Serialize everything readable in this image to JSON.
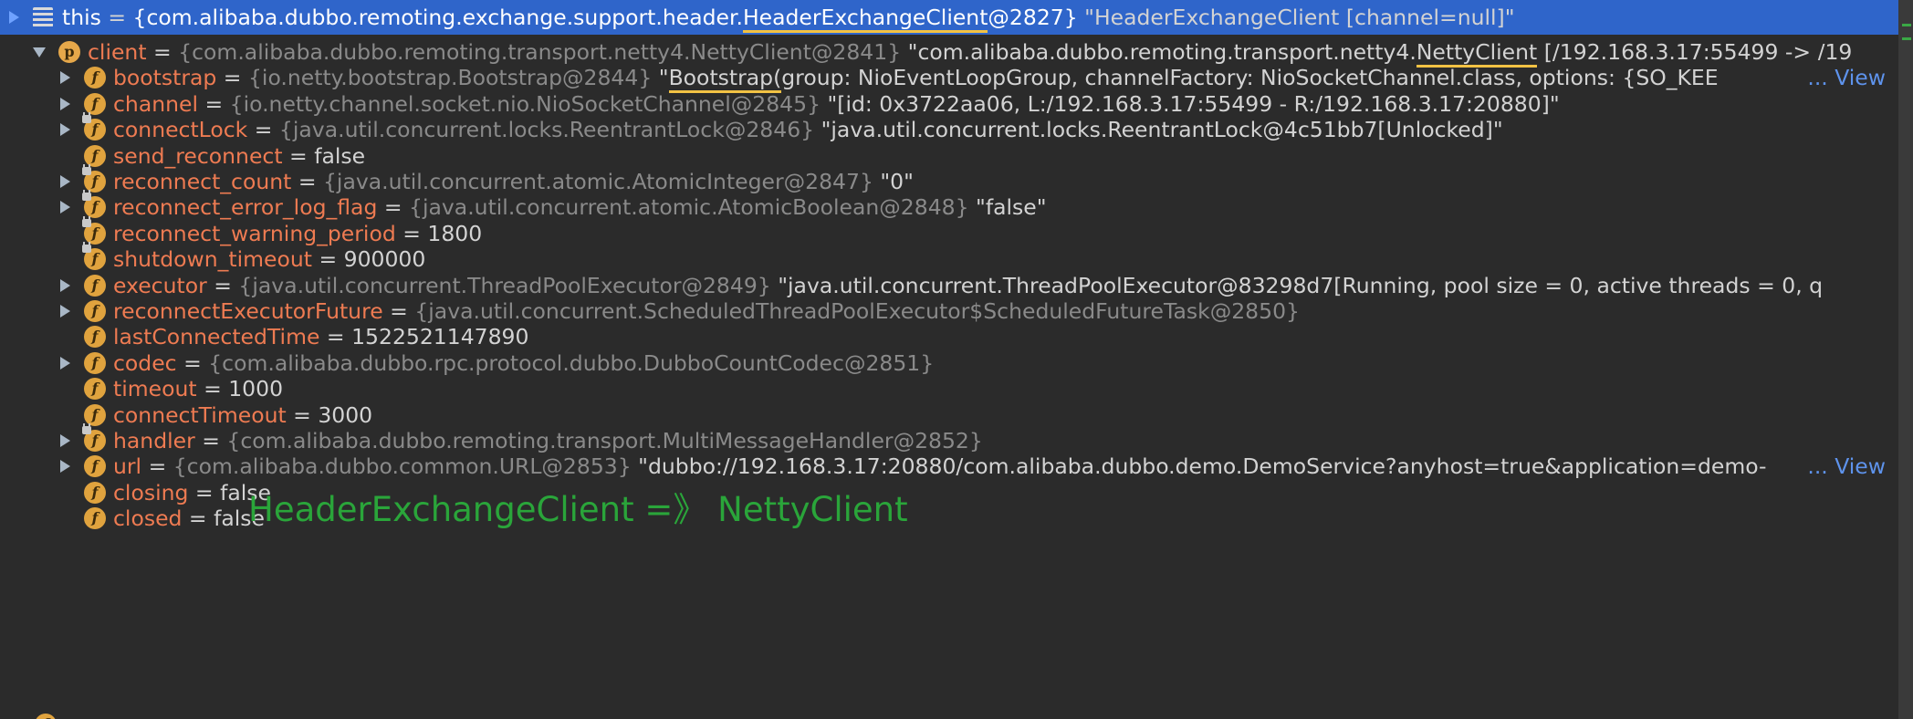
{
  "rows": [
    {
      "id": "this",
      "indent": 0,
      "arrow": "right",
      "icon": "lines",
      "selected": true,
      "name": "this",
      "sep": " = ",
      "gray": "{com.alibaba.dubbo.remoting.exchange.support.header.",
      "gray_ul": "HeaderExchangeClient",
      "gray_tail": "@2827}",
      "value": " \"HeaderExchangeClient [channel=null]\""
    },
    {
      "id": "client",
      "indent": 1,
      "arrow": "down",
      "icon": "p",
      "name": "client",
      "sep": " = ",
      "gray": "{com.alibaba.dubbo.remoting.transport.netty4.NettyClient@2841}",
      "value": " \"com.alibaba.dubbo.remoting.transport.netty4.",
      "value_ul": "NettyClient",
      "value_tail": " [/192.168.3.17:55499 -> /19"
    },
    {
      "id": "bootstrap",
      "indent": 2,
      "arrow": "right",
      "icon": "f",
      "name": "bootstrap",
      "sep": " = ",
      "gray": "{io.netty.bootstrap.Bootstrap@2844}",
      "value": " \"",
      "value_ul": "Bootstrap(",
      "value_tail": "group: NioEventLoopGroup, channelFactory: NioSocketChannel.class, options: {SO_KEE",
      "view": "... View"
    },
    {
      "id": "channel",
      "indent": 2,
      "arrow": "right",
      "icon": "f",
      "name": "channel",
      "sep": " = ",
      "gray": "{io.netty.channel.socket.nio.NioSocketChannel@2845}",
      "value": " \"[id: 0x3722aa06, L:/192.168.3.17:55499 - R:/192.168.3.17:20880]\""
    },
    {
      "id": "connectLock",
      "indent": 2,
      "arrow": "right",
      "icon": "f",
      "lock": true,
      "name": "connectLock",
      "sep": " = ",
      "gray": "{java.util.concurrent.locks.ReentrantLock@2846}",
      "value": " \"java.util.concurrent.locks.ReentrantLock@4c51bb7[Unlocked]\""
    },
    {
      "id": "send_reconnect",
      "indent": 2,
      "arrow": "none",
      "icon": "f",
      "name": "send_reconnect",
      "sep": " = ",
      "value": "false"
    },
    {
      "id": "reconnect_count",
      "indent": 2,
      "arrow": "right",
      "icon": "f",
      "lock": true,
      "name": "reconnect_count",
      "sep": " = ",
      "gray": "{java.util.concurrent.atomic.AtomicInteger@2847}",
      "value": " \"0\""
    },
    {
      "id": "reconnect_error_log_flag",
      "indent": 2,
      "arrow": "right",
      "icon": "f",
      "lock": true,
      "name": "reconnect_error_log_flag",
      "sep": " = ",
      "gray": "{java.util.concurrent.atomic.AtomicBoolean@2848}",
      "value": " \"false\""
    },
    {
      "id": "reconnect_warning_period",
      "indent": 2,
      "arrow": "none",
      "icon": "f",
      "lock": true,
      "name": "reconnect_warning_period",
      "sep": " = ",
      "value": "1800"
    },
    {
      "id": "shutdown_timeout",
      "indent": 2,
      "arrow": "none",
      "icon": "f",
      "lock": true,
      "name": "shutdown_timeout",
      "sep": " = ",
      "value": "900000"
    },
    {
      "id": "executor",
      "indent": 2,
      "arrow": "right",
      "icon": "f",
      "name": "executor",
      "sep": " = ",
      "gray": "{java.util.concurrent.ThreadPoolExecutor@2849}",
      "value": " \"java.util.concurrent.ThreadPoolExecutor@83298d7[Running, pool size = 0, active threads = 0, q"
    },
    {
      "id": "reconnectExecutorFuture",
      "indent": 2,
      "arrow": "right",
      "icon": "f",
      "name": "reconnectExecutorFuture",
      "sep": " = ",
      "gray": "{java.util.concurrent.ScheduledThreadPoolExecutor$ScheduledFutureTask@2850}"
    },
    {
      "id": "lastConnectedTime",
      "indent": 2,
      "arrow": "none",
      "icon": "f",
      "name": "lastConnectedTime",
      "sep": " = ",
      "value": "1522521147890"
    },
    {
      "id": "codec",
      "indent": 2,
      "arrow": "right",
      "icon": "f",
      "name": "codec",
      "sep": " = ",
      "gray": "{com.alibaba.dubbo.rpc.protocol.dubbo.DubboCountCodec@2851}"
    },
    {
      "id": "timeout",
      "indent": 2,
      "arrow": "none",
      "icon": "f",
      "name": "timeout",
      "sep": " = ",
      "value": "1000"
    },
    {
      "id": "connectTimeout",
      "indent": 2,
      "arrow": "none",
      "icon": "f",
      "name": "connectTimeout",
      "sep": " = ",
      "value": "3000"
    },
    {
      "id": "handler",
      "indent": 2,
      "arrow": "right",
      "icon": "f",
      "lock": true,
      "name": "handler",
      "sep": " = ",
      "gray": "{com.alibaba.dubbo.remoting.transport.MultiMessageHandler@2852}"
    },
    {
      "id": "url",
      "indent": 2,
      "arrow": "right",
      "icon": "f",
      "name": "url",
      "sep": " = ",
      "gray": "{com.alibaba.dubbo.common.URL@2853}",
      "value": " \"dubbo://192.168.3.17:20880/com.alibaba.dubbo.demo.DemoService?anyhost=true&application=demo-",
      "view": "... View"
    },
    {
      "id": "closing",
      "indent": 2,
      "arrow": "none",
      "icon": "f",
      "name": "closing",
      "sep": " = ",
      "value": "false"
    },
    {
      "id": "closed",
      "indent": 2,
      "arrow": "none",
      "icon": "f",
      "name": "closed",
      "sep": " = ",
      "value": "false"
    }
  ],
  "caption": "HeaderExchangeClient =》 NettyClient",
  "colors": {
    "background": "#2b2b2b",
    "selection": "#2f65ca",
    "field_name": "#ee7b52",
    "type_text": "#8a8a8a",
    "value_text": "#d3d3d3",
    "view_link": "#5e93ec",
    "underline": "#f2c244",
    "caption": "#2aa53a"
  },
  "icons": {
    "this": "object-lines-icon",
    "p": "property-p-icon",
    "f": "field-f-icon",
    "lock": "lock-overlay-icon",
    "expand": "chevron-right-icon",
    "collapse": "chevron-down-icon"
  },
  "badge_labels": {
    "f": "f",
    "p": "p"
  }
}
